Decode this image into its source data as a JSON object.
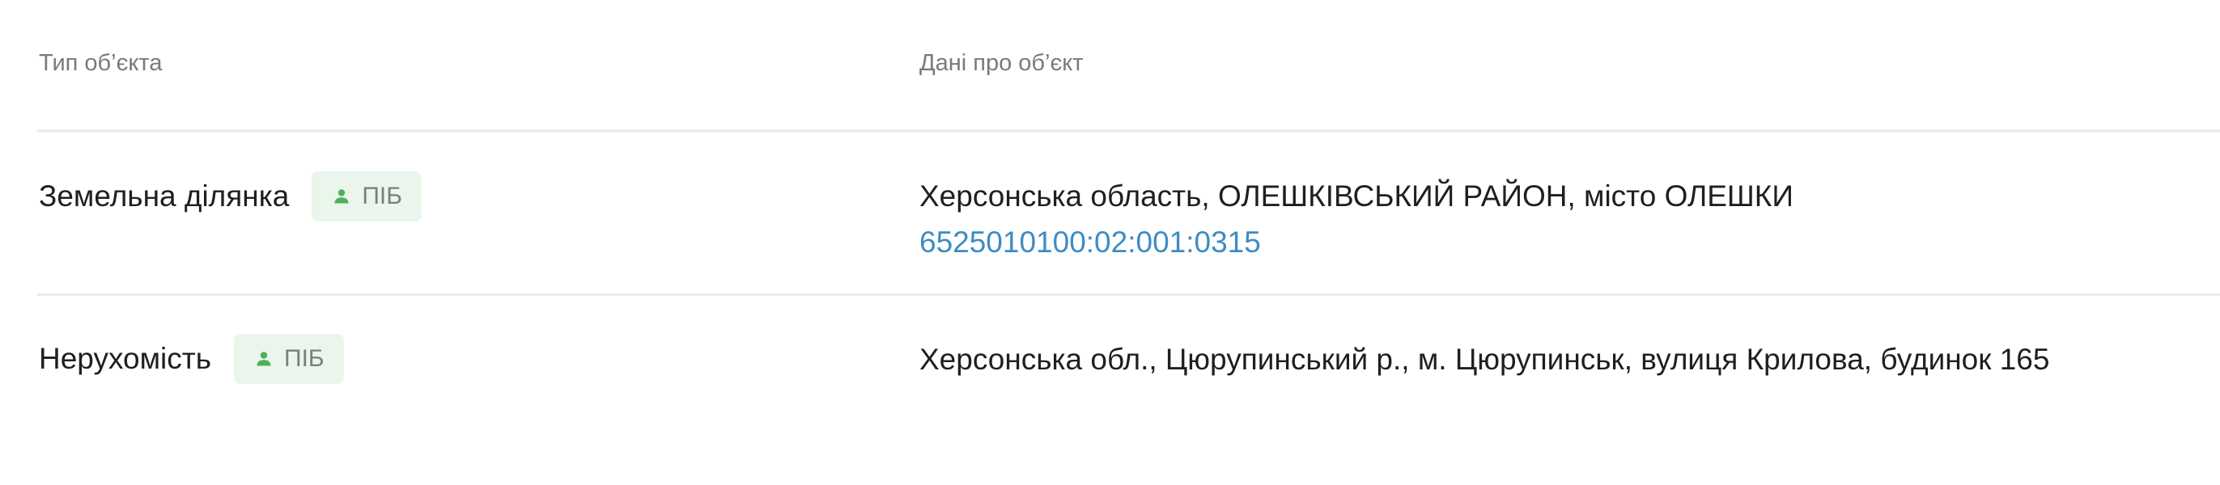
{
  "table": {
    "headers": {
      "object_type": "Тип об’єкта",
      "object_data": "Дані про об’єкт"
    },
    "rows": [
      {
        "type": "Земельна ділянка",
        "badge": "ПІБ",
        "address": "Херсонська область, ОЛЕШКІВСЬКИЙ РАЙОН, місто ОЛЕШКИ",
        "cadastral_number": "6525010100:02:001:0315"
      },
      {
        "type": "Нерухомість",
        "badge": "ПІБ",
        "address": "Херсонська обл., Цюрупинський р., м. Цюрупинськ, вулиця Крилова, будинок 165"
      }
    ]
  },
  "icons": {
    "badge_icon": "person-icon"
  },
  "colors": {
    "badge_background": "#eaf6ec",
    "badge_icon": "#4cb05c",
    "link": "#3d8cc4",
    "header_text": "#7a7a7a",
    "divider": "#ececec"
  }
}
